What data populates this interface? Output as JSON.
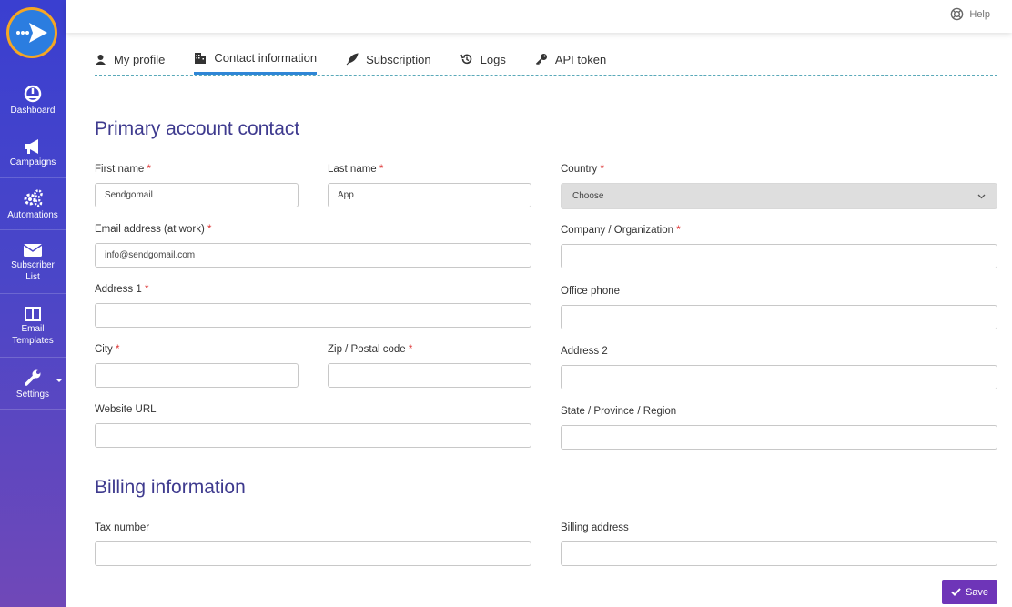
{
  "sidebar": {
    "logo_icon": "paper-plane-logo-icon",
    "items": [
      {
        "label": "Dashboard",
        "icon": "dashboard-icon"
      },
      {
        "label": "Campaigns",
        "icon": "megaphone-icon"
      },
      {
        "label": "Automations",
        "icon": "gears-icon"
      },
      {
        "label": "Subscriber List",
        "icon": "envelope-icon"
      },
      {
        "label": "Email Templates",
        "icon": "columns-icon"
      },
      {
        "label": "Settings",
        "icon": "wrench-icon"
      }
    ]
  },
  "topbar": {
    "help_label": "Help"
  },
  "tabs": [
    {
      "label": "My profile",
      "icon": "user-icon"
    },
    {
      "label": "Contact information",
      "icon": "building-icon",
      "active": true
    },
    {
      "label": "Subscription",
      "icon": "feather-icon"
    },
    {
      "label": "Logs",
      "icon": "history-icon"
    },
    {
      "label": "API token",
      "icon": "key-icon"
    }
  ],
  "primary": {
    "title": "Primary account contact",
    "first_name": {
      "label": "First name",
      "required": "*",
      "value": "Sendgomail"
    },
    "last_name": {
      "label": "Last name",
      "required": "*",
      "value": "App"
    },
    "email": {
      "label": "Email address (at work)",
      "required": "*",
      "value": "info@sendgomail.com"
    },
    "address1": {
      "label": "Address 1",
      "required": "*",
      "value": ""
    },
    "city": {
      "label": "City",
      "required": "*",
      "value": ""
    },
    "zip": {
      "label": "Zip / Postal code",
      "required": "*",
      "value": ""
    },
    "website": {
      "label": "Website URL",
      "value": ""
    },
    "country": {
      "label": "Country",
      "required": "*",
      "value": "Choose"
    },
    "company": {
      "label": "Company / Organization",
      "required": "*",
      "value": ""
    },
    "office_phone": {
      "label": "Office phone",
      "value": ""
    },
    "address2": {
      "label": "Address 2",
      "value": ""
    },
    "state": {
      "label": "State / Province / Region",
      "value": ""
    }
  },
  "billing": {
    "title": "Billing information",
    "tax_number": {
      "label": "Tax number",
      "value": ""
    },
    "billing_address": {
      "label": "Billing address",
      "value": ""
    }
  },
  "save_label": "Save",
  "colors": {
    "sidebar_top": "#3a3fd0",
    "sidebar_bottom": "#7048b8",
    "heading": "#3e3a8e",
    "tab_active": "#2f86d6",
    "save_button": "#6e35b8",
    "required": "#dd3333"
  }
}
